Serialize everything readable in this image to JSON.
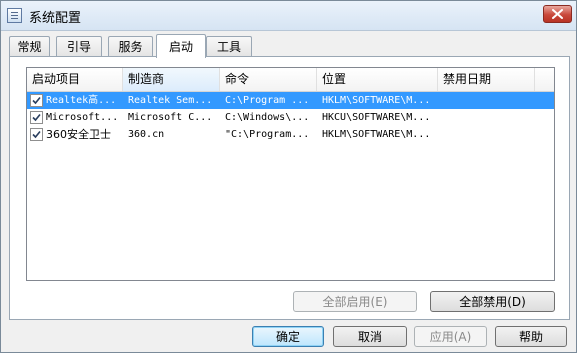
{
  "window": {
    "title": "系统配置"
  },
  "tabs": [
    {
      "label": "常规"
    },
    {
      "label": "引导"
    },
    {
      "label": "服务"
    },
    {
      "label": "启动"
    },
    {
      "label": "工具"
    }
  ],
  "startup_list": {
    "columns": [
      "启动项目",
      "制造商",
      "命令",
      "位置",
      "禁用日期"
    ],
    "rows": [
      {
        "checked": true,
        "selected": true,
        "item": "Realtek高...",
        "maker": "Realtek Sem...",
        "command": "C:\\Program ...",
        "location": "HKLM\\SOFTWARE\\M...",
        "disabled_date": ""
      },
      {
        "checked": true,
        "selected": false,
        "item": "Microsoft...",
        "maker": "Microsoft C...",
        "command": "C:\\Windows\\...",
        "location": "HKCU\\SOFTWARE\\M...",
        "disabled_date": ""
      },
      {
        "checked": true,
        "selected": false,
        "item": "360安全卫士",
        "maker": "360.cn",
        "command": "\"C:\\Program...",
        "location": "HKLM\\SOFTWARE\\M...",
        "disabled_date": ""
      }
    ]
  },
  "panel_buttons": {
    "enable_all": "全部启用(E)",
    "disable_all": "全部禁用(D)"
  },
  "footer_buttons": {
    "ok": "确定",
    "cancel": "取消",
    "apply": "应用(A)",
    "help": "帮助"
  },
  "icons": {
    "app": "system-config-icon",
    "close": "close-icon",
    "check": "checkmark-icon"
  },
  "colors": {
    "selection": "#3399ff",
    "close_button": "#c9483b"
  }
}
